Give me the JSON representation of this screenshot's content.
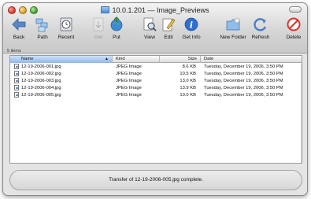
{
  "window": {
    "title": "10.0.1.201 — Image_Previews"
  },
  "toolbar": {
    "back": {
      "label": "Back",
      "icon": "back-arrow-icon"
    },
    "path": {
      "label": "Path",
      "icon": "path-icon"
    },
    "recent": {
      "label": "Recent",
      "icon": "recent-icon"
    },
    "get": {
      "label": "Get",
      "icon": "get-icon",
      "enabled": false
    },
    "put": {
      "label": "Put",
      "icon": "put-icon"
    },
    "view": {
      "label": "View",
      "icon": "view-icon"
    },
    "edit": {
      "label": "Edit",
      "icon": "edit-icon"
    },
    "getinfo": {
      "label": "Get Info",
      "icon": "info-icon"
    },
    "newfolder": {
      "label": "New Folder",
      "icon": "new-folder-icon"
    },
    "refresh": {
      "label": "Refresh",
      "icon": "refresh-icon"
    },
    "delete": {
      "label": "Delete",
      "icon": "delete-icon"
    }
  },
  "status": {
    "items": "5 items"
  },
  "list": {
    "columns": {
      "name": "Name",
      "kind": "Kind",
      "size": "Size",
      "date": "Date"
    },
    "sorted_column": "name",
    "rows": [
      {
        "name": "12-19-2006-001.jpg",
        "kind": "JPEG Image",
        "size": "8.6 KB",
        "date": "Tuesday, December 19, 2006, 3:50 PM"
      },
      {
        "name": "12-19-2006-002.jpg",
        "kind": "JPEG Image",
        "size": "10.5 KB",
        "date": "Tuesday, December 19, 2006, 3:50 PM"
      },
      {
        "name": "12-19-2006-003.jpg",
        "kind": "JPEG Image",
        "size": "13.0 KB",
        "date": "Tuesday, December 19, 2006, 3:50 PM"
      },
      {
        "name": "12-19-2006-004.jpg",
        "kind": "JPEG Image",
        "size": "13.9 KB",
        "date": "Tuesday, December 19, 2006, 3:50 PM"
      },
      {
        "name": "12-19-2006-005.jpg",
        "kind": "JPEG Image",
        "size": "10.0 KB",
        "date": "Tuesday, December 19, 2006, 3:50 PM"
      }
    ]
  },
  "transfer": {
    "message": "Transfer of 12-19-2006-005.jpg complete."
  },
  "colors": {
    "accent": "#4f8ed6",
    "delete": "#d8342a"
  }
}
